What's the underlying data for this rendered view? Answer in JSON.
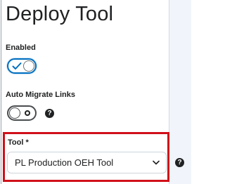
{
  "page": {
    "title": "Deploy Tool"
  },
  "fields": {
    "enabled": {
      "label": "Enabled",
      "toggle_state": "on"
    },
    "auto_migrate_links": {
      "label": "Auto Migrate Links",
      "toggle_state": "off",
      "help_glyph": "?"
    },
    "tool": {
      "label": "Tool *",
      "selected_value": "PL Production OEH Tool",
      "help_glyph": "?"
    }
  },
  "icons": {
    "enabled_toggle": "checkmark-icon",
    "auto_migrate_toggle": "ring-icon",
    "help": "question-circle-icon",
    "dropdown": "chevron-down-icon"
  },
  "colors": {
    "highlight": "#d0101a",
    "toggle_on_accent": "#006fbf",
    "right_panel": "#f1f5fb"
  }
}
